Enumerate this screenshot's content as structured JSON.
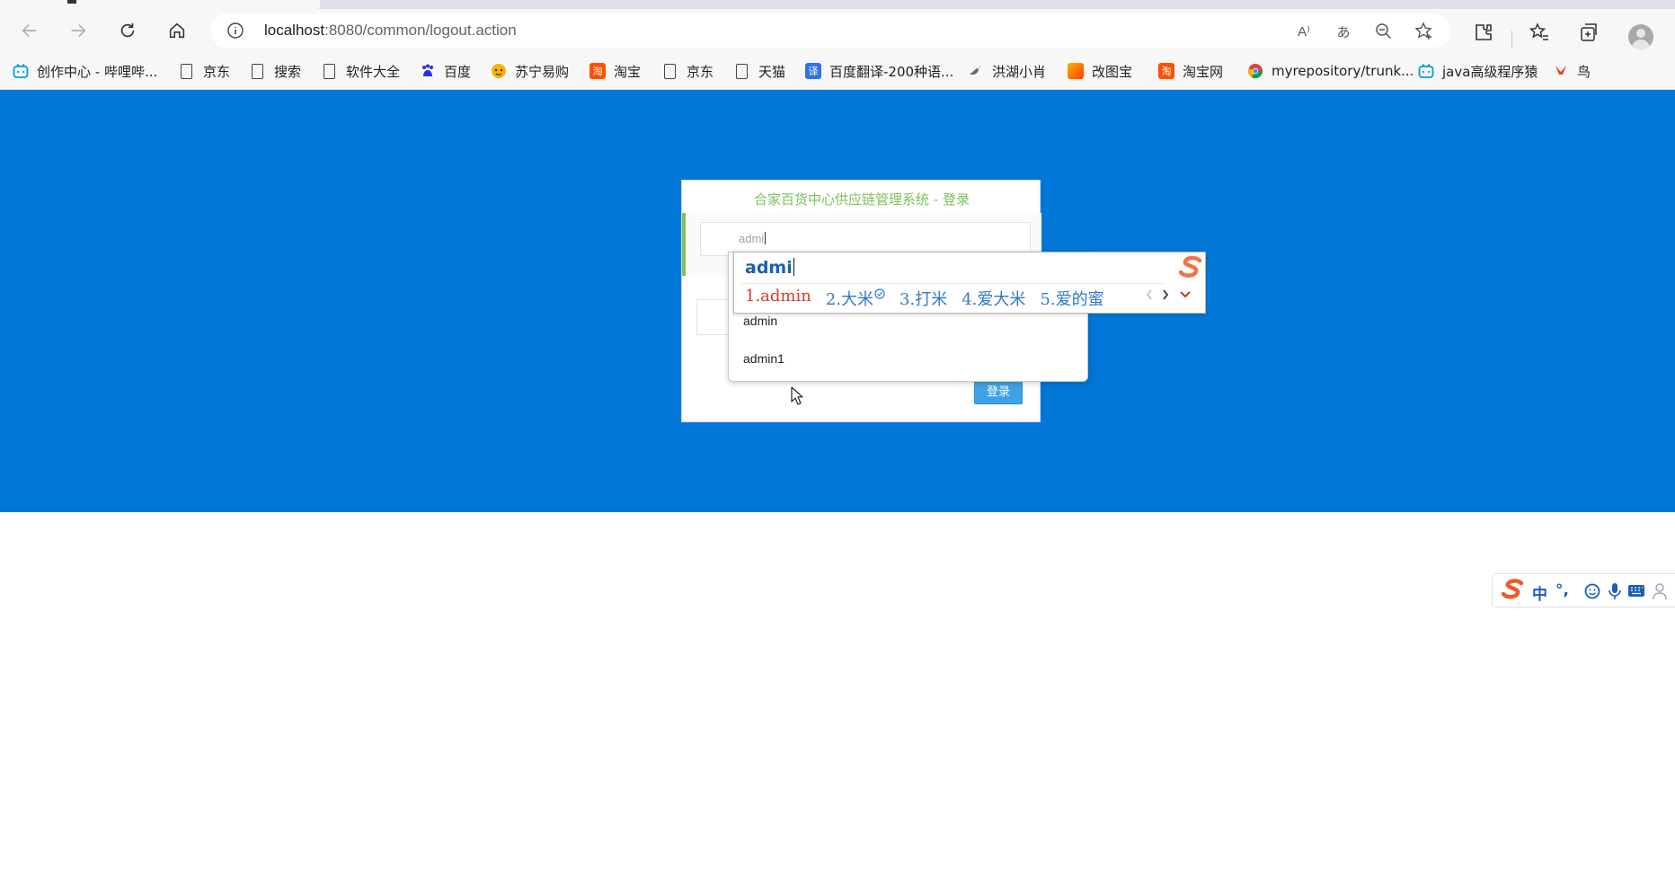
{
  "browser": {
    "url_host": "localhost",
    "url_rest": ":8080/common/logout.action"
  },
  "bookmarks": [
    {
      "label": "创作中心 - 哔哩哔...",
      "icon": "bilibili-icon"
    },
    {
      "label": "京东",
      "icon": "page-icon"
    },
    {
      "label": "搜索",
      "icon": "page-icon"
    },
    {
      "label": "软件大全",
      "icon": "page-icon"
    },
    {
      "label": "百度",
      "icon": "baidu-icon"
    },
    {
      "label": "苏宁易购",
      "icon": "suning-icon"
    },
    {
      "label": "淘宝",
      "icon": "taobao-icon"
    },
    {
      "label": "京东",
      "icon": "page-icon"
    },
    {
      "label": "天猫",
      "icon": "page-icon"
    },
    {
      "label": "百度翻译-200种语...",
      "icon": "baidu-translate-icon"
    },
    {
      "label": "洪湖小肖",
      "icon": "bird-icon"
    },
    {
      "label": "改图宝",
      "icon": "gaitubao-icon"
    },
    {
      "label": "淘宝网",
      "icon": "taobao-icon"
    },
    {
      "label": "myrepository/trunk...",
      "icon": "chrome-icon"
    },
    {
      "label": "java高级程序猿",
      "icon": "bilibili-icon"
    },
    {
      "label": "鸟",
      "icon": "bird-icon"
    }
  ],
  "login": {
    "title": "合家百货中心供应链管理系统 - 登录",
    "username_value": "admi",
    "button_label": "登录"
  },
  "autocomplete": {
    "items": [
      "admin",
      "admin1"
    ]
  },
  "ime": {
    "composition": "admi",
    "candidates": [
      "1.admin",
      "2.大米",
      "3.打米",
      "4.爱大米",
      "5.爱的蜜"
    ],
    "status_mode": "中",
    "status_punct": "°,"
  },
  "colors": {
    "page_background": "#0077d6",
    "title_green": "#7cc05a",
    "button_blue": "#3ea3e6",
    "ime_red": "#d63b2f",
    "ime_blue": "#2f79c6",
    "sogou_orange": "#f05a28"
  }
}
